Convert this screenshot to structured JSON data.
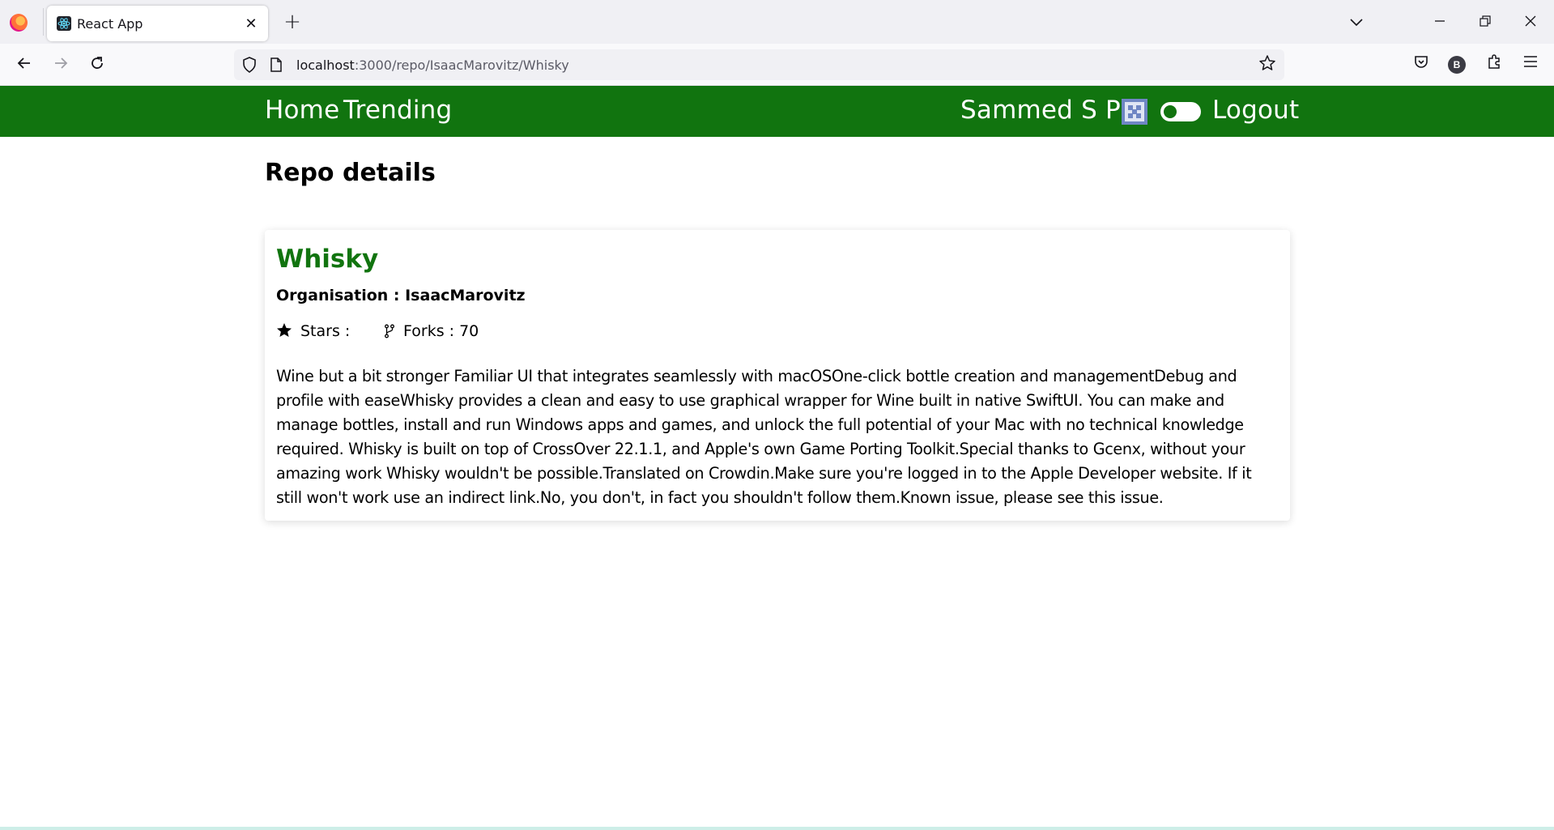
{
  "browser": {
    "tab_title": "React App",
    "tab_close": "✕",
    "new_tab": "+",
    "url_host": "localhost",
    "url_path": ":3000/repo/IsaacMarovitz/Whisky",
    "profile_initial": "B"
  },
  "header": {
    "home": "Home",
    "trending": "Trending",
    "username": "Sammed S P",
    "logout": "Logout"
  },
  "page": {
    "title": "Repo details"
  },
  "repo": {
    "name": "Whisky",
    "organisation": "Organisation : IsaacMarovitz",
    "stars_label": "Stars :",
    "forks_label": "Forks : 70",
    "description": "Wine but a bit stronger Familiar UI that integrates seamlessly with macOSOne-click bottle creation and managementDebug and profile with easeWhisky provides a clean and easy to use graphical wrapper for Wine built in native SwiftUI. You can make and manage bottles, install and run Windows apps and games, and unlock the full potential of your Mac with no technical knowledge required. Whisky is built on top of CrossOver 22.1.1, and Apple's own Game Porting Toolkit.Special thanks to Gcenx, without your amazing work Whisky wouldn't be possible.Translated on Crowdin.Make sure you're logged in to the Apple Developer website. If it still won't work use an indirect link.No, you don't, in fact you shouldn't follow them.Known issue, please see this issue."
  },
  "colors": {
    "accent": "#11740f",
    "avatar": "#6f86c4"
  }
}
